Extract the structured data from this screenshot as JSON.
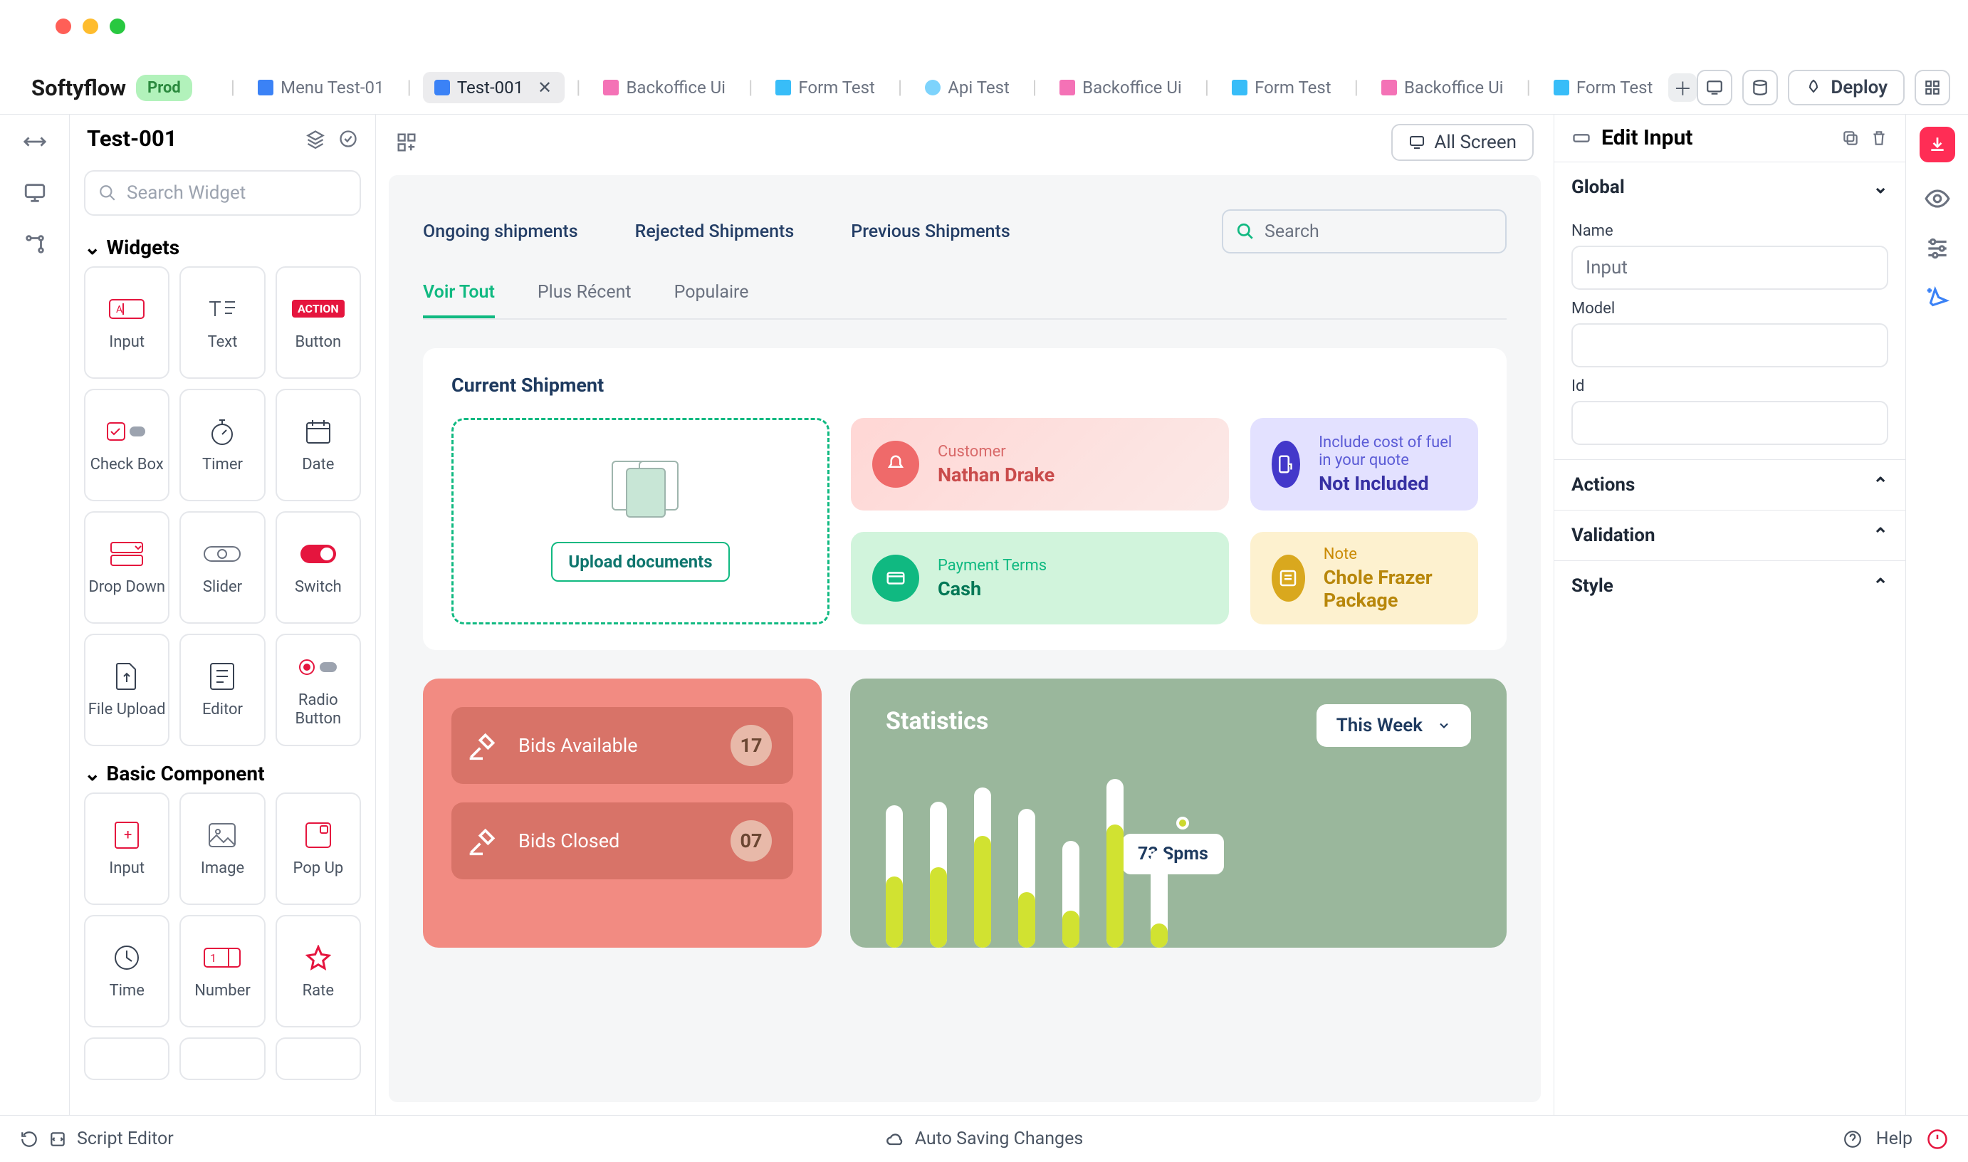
{
  "brand": "Softyflow",
  "env_badge": "Prod",
  "tabs": [
    {
      "label": "Menu Test-01",
      "type": "menu"
    },
    {
      "label": "Test-001",
      "type": "ui",
      "active": true,
      "closable": true
    },
    {
      "label": "Backoffice Ui",
      "type": "bo"
    },
    {
      "label": "Form Test",
      "type": "form"
    },
    {
      "label": "Api Test",
      "type": "api"
    },
    {
      "label": "Backoffice Ui",
      "type": "bo"
    },
    {
      "label": "Form Test",
      "type": "form"
    },
    {
      "label": "Backoffice Ui",
      "type": "bo"
    },
    {
      "label": "Form Test",
      "type": "form"
    }
  ],
  "deploy_label": "Deploy",
  "widgets": {
    "title": "Test-001",
    "search_placeholder": "Search Widget",
    "group1": "Widgets",
    "items1": [
      "Input",
      "Text",
      "Button",
      "Check Box",
      "Timer",
      "Date",
      "Drop Down",
      "Slider",
      "Switch",
      "File Upload",
      "Editor",
      "Radio Button"
    ],
    "group2": "Basic Component",
    "items2": [
      "Input",
      "Image",
      "Pop Up",
      "Time",
      "Number",
      "Rate"
    ]
  },
  "canvas": {
    "all_screen": "All Screen",
    "ship_tabs": [
      "Ongoing shipments",
      "Rejected Shipments",
      "Previous Shipments"
    ],
    "search_placeholder": "Search",
    "filters": [
      "Voir Tout",
      "Plus Récent",
      "Populaire"
    ],
    "current_shipment_title": "Current Shipment",
    "cards": {
      "customer": {
        "sub": "Customer",
        "main": "Nathan Drake"
      },
      "fuel": {
        "sub": "Include cost of fuel in your quote",
        "main": "Not Included"
      },
      "payment": {
        "sub": "Payment Terms",
        "main": "Cash"
      },
      "note": {
        "sub": "Note",
        "main": "Chole Frazer Package"
      }
    },
    "upload_label": "Upload documents",
    "bids": {
      "avail": {
        "t": "Bids Available",
        "n": "17"
      },
      "closed": {
        "t": "Bids Closed",
        "n": "07"
      }
    },
    "stats": {
      "title": "Statistics",
      "week": "This Week",
      "tooltip": "73 Spms"
    }
  },
  "rightpane": {
    "title": "Edit Input",
    "sections": {
      "global": {
        "title": "Global",
        "name_label": "Name",
        "name_value": "Input",
        "model_label": "Model",
        "id_label": "Id"
      },
      "actions": "Actions",
      "validation": "Validation",
      "style": "Style"
    }
  },
  "statusbar": {
    "script": "Script Editor",
    "auto": "Auto Saving Changes",
    "help": "Help"
  },
  "chart_data": {
    "type": "bar",
    "title": "Statistics",
    "filter": "This Week",
    "ylabel": "",
    "xlabel": "",
    "ylim": [
      0,
      100
    ],
    "tooltip_value": "73 Spms",
    "series": [
      {
        "name": "Spms",
        "values": [
          50,
          55,
          70,
          40,
          35,
          73,
          25
        ]
      }
    ],
    "track_height_pct": [
      80,
      82,
      90,
      78,
      60,
      95,
      55
    ]
  }
}
